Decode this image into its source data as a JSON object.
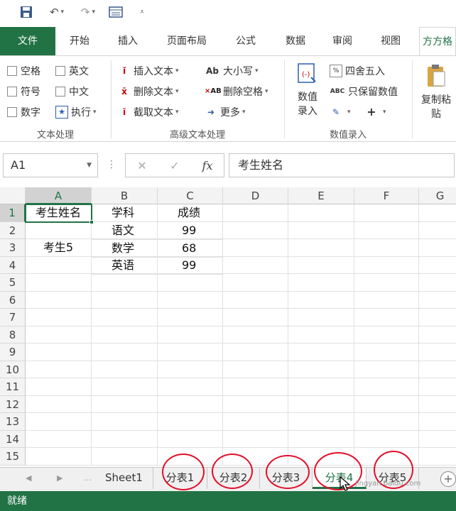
{
  "qat": {
    "save_icon": "save-icon",
    "undo_icon": "undo-icon",
    "redo_icon": "redo-icon",
    "form_icon": "form-icon",
    "customize_icon": "customize-qat-icon"
  },
  "tabs": {
    "file": "文件",
    "home": "开始",
    "insert": "插入",
    "layout": "页面布局",
    "formulas": "公式",
    "data": "数据",
    "review": "审阅",
    "view": "视图",
    "addin": "方方格"
  },
  "ribbon": {
    "text_group": {
      "space": "空格",
      "english": "英文",
      "symbol": "符号",
      "chinese": "中文",
      "number": "数字",
      "execute": "执行",
      "label": "文本处理"
    },
    "adv_group": {
      "insert_text": "插入文本",
      "delete_text": "删除文本",
      "extract_text": "截取文本",
      "case": "大小写",
      "delete_space": "删除空格",
      "more": "更多",
      "label": "高级文本处理"
    },
    "num_group": {
      "numeric_entry": "数值录入",
      "round": "四舍五入",
      "keep_values": "只保留数值",
      "label": "数值录入"
    },
    "paste": {
      "label": "复制粘贴"
    }
  },
  "formula_bar": {
    "name_box": "A1",
    "fx": "fx",
    "cancel": "✕",
    "confirm": "✓",
    "content": "考生姓名"
  },
  "grid": {
    "columns": [
      "A",
      "B",
      "C",
      "D",
      "E",
      "F",
      "G"
    ],
    "rows": [
      "1",
      "2",
      "3",
      "4",
      "5",
      "6",
      "7",
      "8",
      "9",
      "10",
      "11",
      "12",
      "13",
      "14",
      "15"
    ],
    "cells": {
      "A1": "考生姓名",
      "B1": "学科",
      "C1": "成绩",
      "A2_4": "考生5",
      "B2": "语文",
      "C2": "99",
      "B3": "数学",
      "C3": "68",
      "B4": "英语",
      "C4": "99"
    }
  },
  "sheets": {
    "tabs": [
      "Sheet1",
      "分表1",
      "分表2",
      "分表3",
      "分表4",
      "分表5"
    ],
    "add": "+"
  },
  "watermark": "jingyan.baidu.com",
  "status": {
    "text": "就绪"
  },
  "colors": {
    "accent": "#217346",
    "annotation": "#e0102a"
  }
}
